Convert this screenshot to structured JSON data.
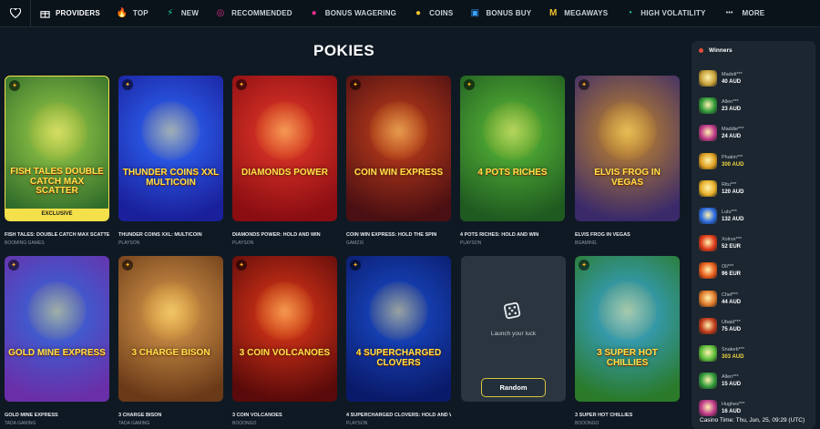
{
  "nav": {
    "items": [
      {
        "label": "PROVIDERS",
        "icon": "gift-icon",
        "color": "#ffffff"
      },
      {
        "label": "TOP",
        "icon": "flame-icon",
        "color": "#ff7a1a"
      },
      {
        "label": "NEW",
        "icon": "lightning-icon",
        "color": "#22d39a"
      },
      {
        "label": "RECOMMENDED",
        "icon": "target-icon",
        "color": "#e0308a"
      },
      {
        "label": "BONUS WAGERING",
        "icon": "coins-stack-icon",
        "color": "#e0308a"
      },
      {
        "label": "COINS",
        "icon": "coins-icon",
        "color": "#f2c12e"
      },
      {
        "label": "BONUS BUY",
        "icon": "cart-icon",
        "color": "#3aa0ff"
      },
      {
        "label": "MEGAWAYS",
        "icon": "m-icon",
        "color": "#f2c12e"
      },
      {
        "label": "HIGH VOLATILITY",
        "icon": "gauge-icon",
        "color": "#22d39a"
      },
      {
        "label": "MORE",
        "icon": "dots-icon",
        "color": "#c9d1d9"
      }
    ]
  },
  "page": {
    "title": "POKIES"
  },
  "games": [
    {
      "name": "FISH TALES: DOUBLE CATCH MAX SCATTER",
      "provider": "BOOMING GAMES",
      "art": "FISH TALES DOUBLE CATCH MAX SCATTER",
      "exclusive": "EXCLUSIVE",
      "bg": [
        "#9fd24a",
        "#2f6b2a"
      ]
    },
    {
      "name": "THUNDER COINS XXL: MULTICOIN",
      "provider": "PLAYSON",
      "art": "THUNDER COINS XXL MULTICOIN",
      "bg": [
        "#2f6cff",
        "#1a1f9a"
      ]
    },
    {
      "name": "DIAMONDS POWER: HOLD AND WIN",
      "provider": "PLAYSON",
      "art": "DIAMONDS POWER",
      "bg": [
        "#e83a2a",
        "#8a0d12"
      ]
    },
    {
      "name": "COIN WIN EXPRESS: HOLD THE SPIN",
      "provider": "GAMZIX",
      "art": "COIN WIN EXPRESS",
      "bg": [
        "#c8401c",
        "#4a0f12"
      ]
    },
    {
      "name": "4 POTS RICHES: HOLD AND WIN",
      "provider": "PLAYSON",
      "art": "4 POTS RICHES",
      "bg": [
        "#5cbf3a",
        "#1f5a20"
      ]
    },
    {
      "name": "ELVIS FROG IN VEGAS",
      "provider": "BGAMING",
      "art": "ELVIS FROG IN VEGAS",
      "bg": [
        "#c98a2a",
        "#3a2a6a"
      ]
    },
    {
      "name": "GOLD MINE EXPRESS",
      "provider": "TADA GAMING",
      "art": "GOLD MINE EXPRESS",
      "bg": [
        "#2e6de0",
        "#6a2fa8"
      ]
    },
    {
      "name": "3 CHARGE BISON",
      "provider": "TADA GAMING",
      "art": "3 CHARGE BISON",
      "bg": [
        "#e0a050",
        "#6a3a18"
      ]
    },
    {
      "name": "3 COIN VOLCANOES",
      "provider": "BOOONGO",
      "art": "3 COIN VOLCANOES",
      "bg": [
        "#e83a1a",
        "#5a0a0a"
      ]
    },
    {
      "name": "4 SUPERCHARGED CLOVERS: HOLD AND W...",
      "provider": "PLAYSON",
      "art": "4 SUPERCHARGED CLOVERS",
      "bg": [
        "#1a4fd0",
        "#0a1a6a"
      ]
    },
    {
      "name": "3 SUPER HOT CHILLIES",
      "provider": "BOOONGO",
      "art": "3 SUPER HOT CHILLIES",
      "bg": [
        "#3aa8e8",
        "#2a7a2a"
      ]
    }
  ],
  "random": {
    "text": "Launch your luck",
    "button": "Random"
  },
  "winners": {
    "title": "Winners",
    "list": [
      {
        "name": "Madeli***",
        "amount": "40 AUD",
        "color": "#c9a23a"
      },
      {
        "name": "Allen***",
        "amount": "23 AUD",
        "color": "#2f9a3a"
      },
      {
        "name": "Maddie***",
        "amount": "24 AUD",
        "color": "#c03a8a"
      },
      {
        "name": "Phakin***",
        "amount": "300 AUD",
        "color": "#e0a020",
        "gold": true
      },
      {
        "name": "Ritu***",
        "amount": "120 AUD",
        "color": "#e8b02a"
      },
      {
        "name": "Lulu***",
        "amount": "132 AUD",
        "color": "#2a6ae0"
      },
      {
        "name": "Xolrox***",
        "amount": "52 EUR",
        "color": "#e03a1a"
      },
      {
        "name": "Oli***",
        "amount": "96 EUR",
        "color": "#e85a1a"
      },
      {
        "name": "Chef***",
        "amount": "44 AUD",
        "color": "#e07a2a"
      },
      {
        "name": "Ubaid***",
        "amount": "75 AUD",
        "color": "#c03a1a"
      },
      {
        "name": "Snakeb***",
        "amount": "303 AUD",
        "color": "#5cbf3a",
        "gold": true
      },
      {
        "name": "Allen***",
        "amount": "15 AUD",
        "color": "#2f9a3a"
      },
      {
        "name": "Hughes***",
        "amount": "16 AUD",
        "color": "#c03a8a"
      }
    ]
  },
  "footer": {
    "casino_time": "Casino Time: Thu, Jun, 25, 09:29 (UTC)"
  }
}
